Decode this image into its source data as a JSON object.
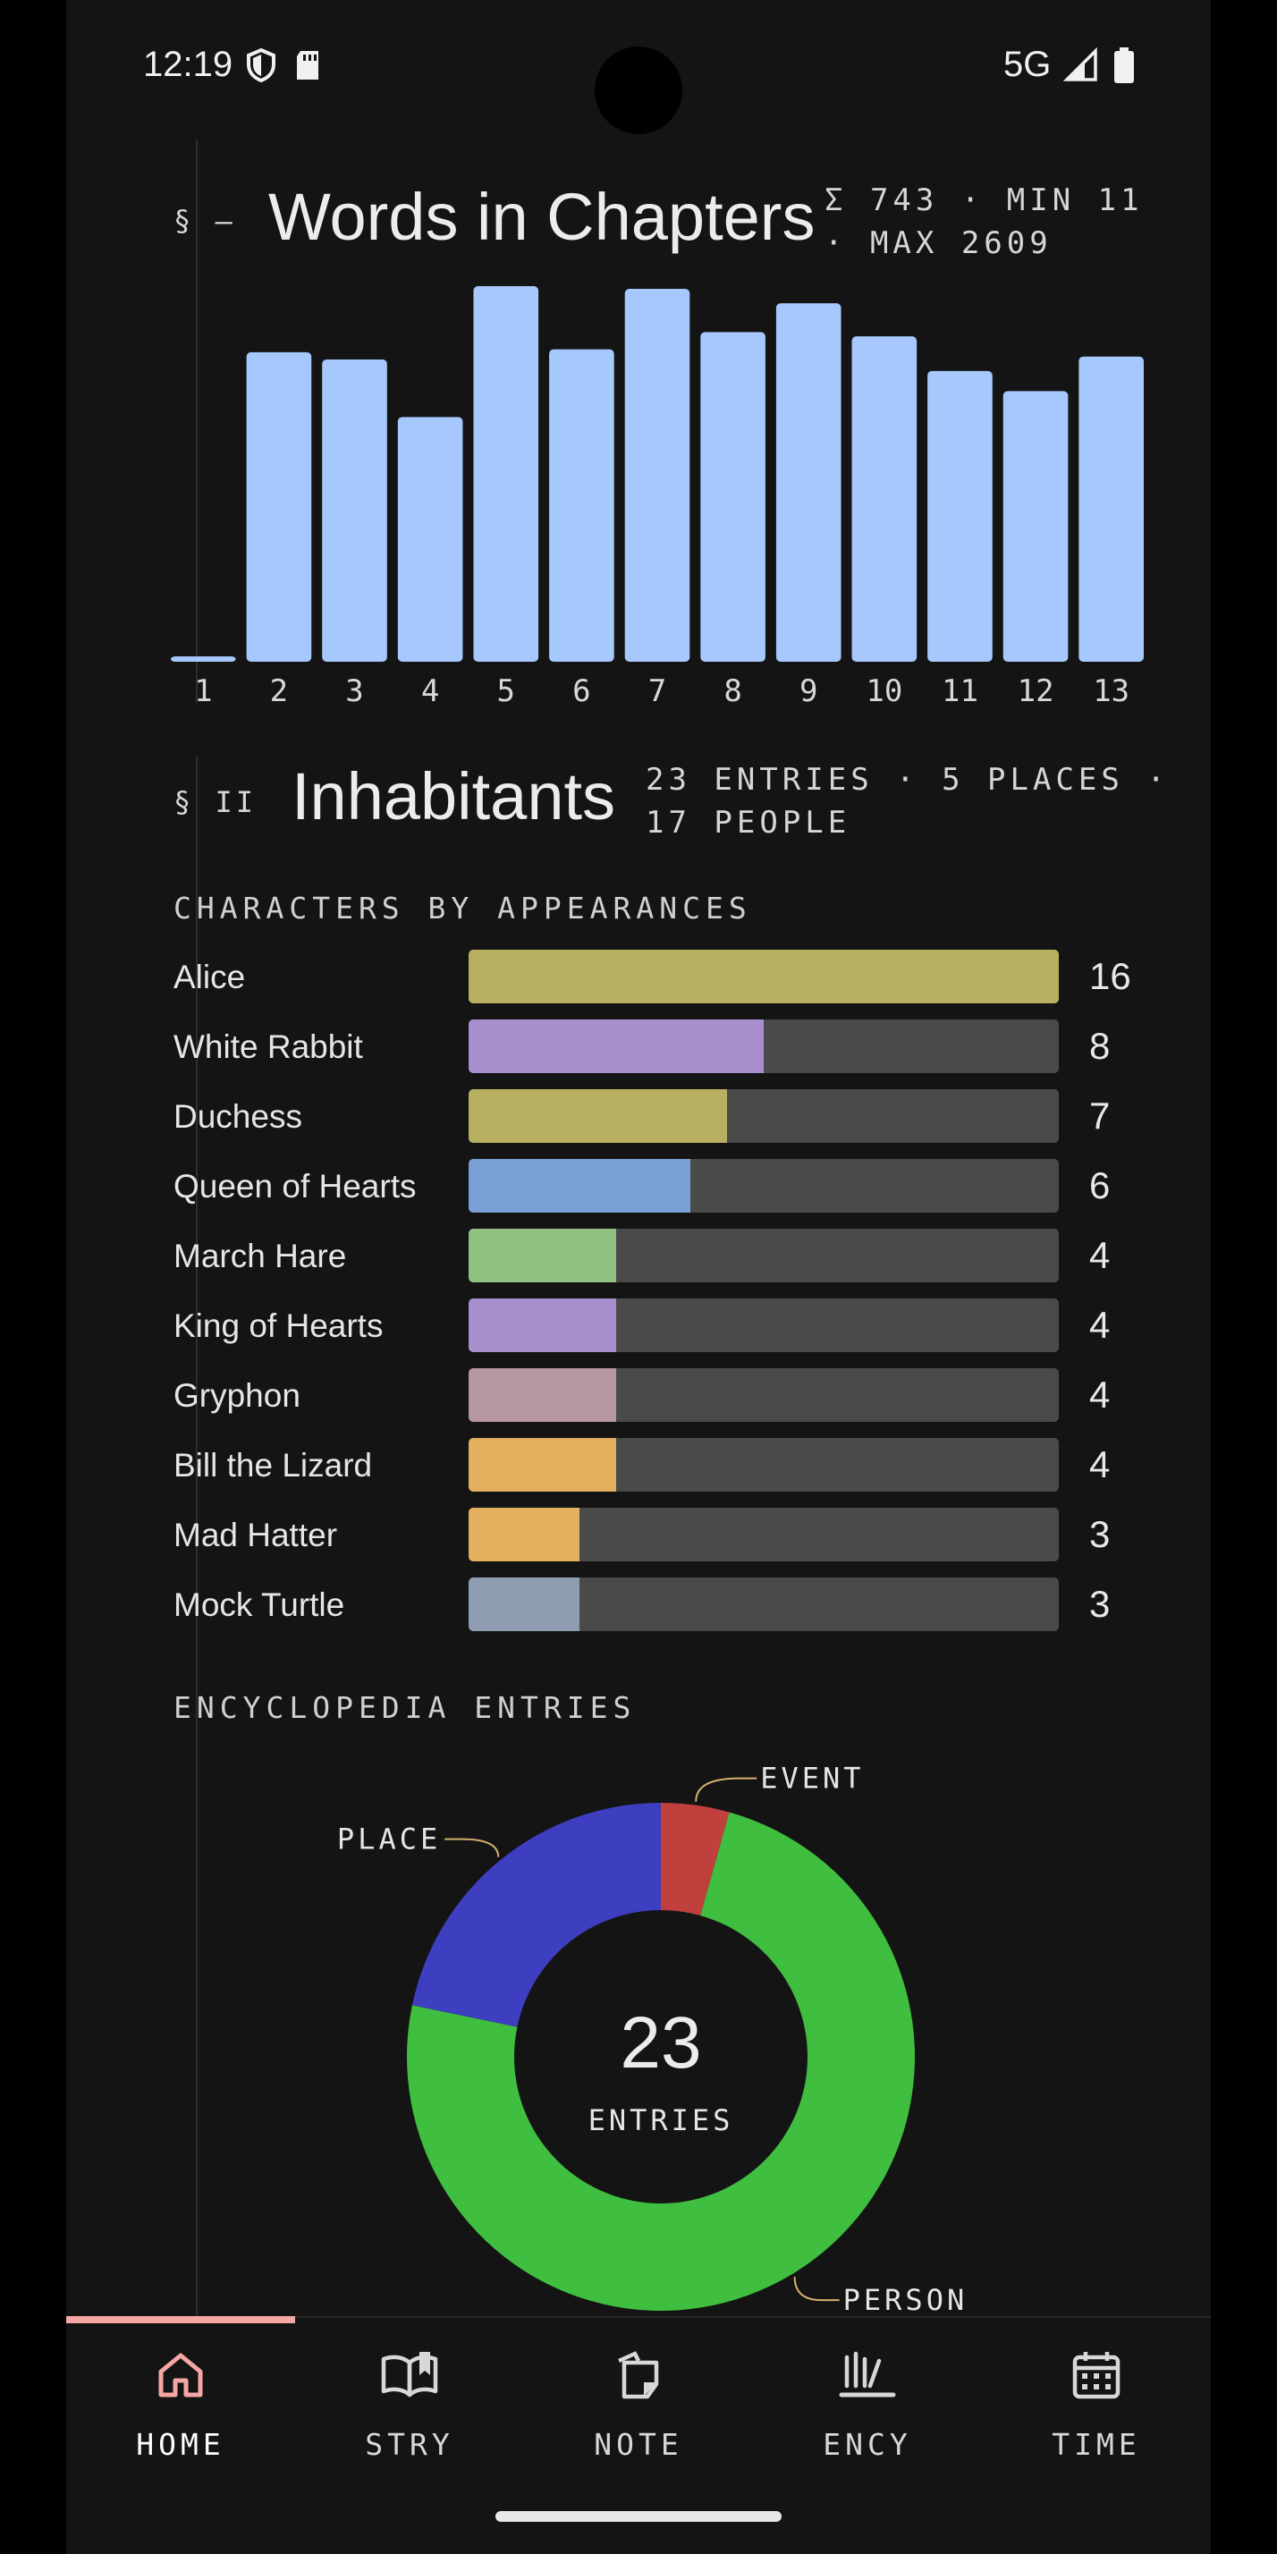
{
  "status_bar": {
    "time": "12:19",
    "network": "5G"
  },
  "section1": {
    "prefix": "§ –",
    "title": "Words in Chapters",
    "meta_line1": "Σ 743 · MIN 11",
    "meta_line2": "· MAX 2609"
  },
  "chart_data": [
    {
      "type": "bar",
      "categories": [
        "1",
        "2",
        "3",
        "4",
        "5",
        "6",
        "7",
        "8",
        "9",
        "10",
        "11",
        "12",
        "13"
      ],
      "values": [
        11,
        2150,
        2100,
        1700,
        2609,
        2170,
        2590,
        2290,
        2490,
        2260,
        2020,
        1880,
        2120
      ],
      "title": "Words in Chapters",
      "ylim": [
        0,
        2609
      ],
      "color": "#a6c8fd",
      "grid": false
    },
    {
      "type": "pie",
      "categories": [
        "EVENT",
        "PERSON",
        "PLACE"
      ],
      "values": [
        1,
        17,
        5
      ],
      "colors": [
        "#c0403e",
        "#3fbe40",
        "#3e3ec0"
      ],
      "center_value": "23",
      "center_label": "ENTRIES"
    }
  ],
  "section2": {
    "prefix": "§ II",
    "title": "Inhabitants",
    "meta_line1": "23 ENTRIES · 5 PLACES ·",
    "meta_line2": "17 PEOPLE"
  },
  "characters_heading": "CHARACTERS BY APPEARANCES",
  "characters": [
    {
      "name": "Alice",
      "count": "16",
      "fraction": 1.0,
      "color": "#b6b060"
    },
    {
      "name": "White Rabbit",
      "count": "8",
      "fraction": 0.5,
      "color": "#a98ecd"
    },
    {
      "name": "Duchess",
      "count": "7",
      "fraction": 0.4375,
      "color": "#b6b060"
    },
    {
      "name": "Queen of Hearts",
      "count": "6",
      "fraction": 0.375,
      "color": "#799fd6"
    },
    {
      "name": "March Hare",
      "count": "4",
      "fraction": 0.25,
      "color": "#8fc280"
    },
    {
      "name": "King of Hearts",
      "count": "4",
      "fraction": 0.25,
      "color": "#a98ecd"
    },
    {
      "name": "Gryphon",
      "count": "4",
      "fraction": 0.25,
      "color": "#b6979f"
    },
    {
      "name": "Bill the Lizard",
      "count": "4",
      "fraction": 0.25,
      "color": "#e4b060"
    },
    {
      "name": "Mad Hatter",
      "count": "3",
      "fraction": 0.1875,
      "color": "#e4b060"
    },
    {
      "name": "Mock Turtle",
      "count": "3",
      "fraction": 0.1875,
      "color": "#8f9db3"
    }
  ],
  "encyclopedia_heading": "ENCYCLOPEDIA ENTRIES",
  "nav": {
    "items": [
      {
        "label": "HOME",
        "icon": "home-icon",
        "active": true
      },
      {
        "label": "STRY",
        "icon": "book-icon",
        "active": false
      },
      {
        "label": "NOTE",
        "icon": "note-icon",
        "active": false
      },
      {
        "label": "ENCY",
        "icon": "library-icon",
        "active": false
      },
      {
        "label": "TIME",
        "icon": "calendar-icon",
        "active": false
      }
    ],
    "active_color": "#f4a7a3"
  }
}
